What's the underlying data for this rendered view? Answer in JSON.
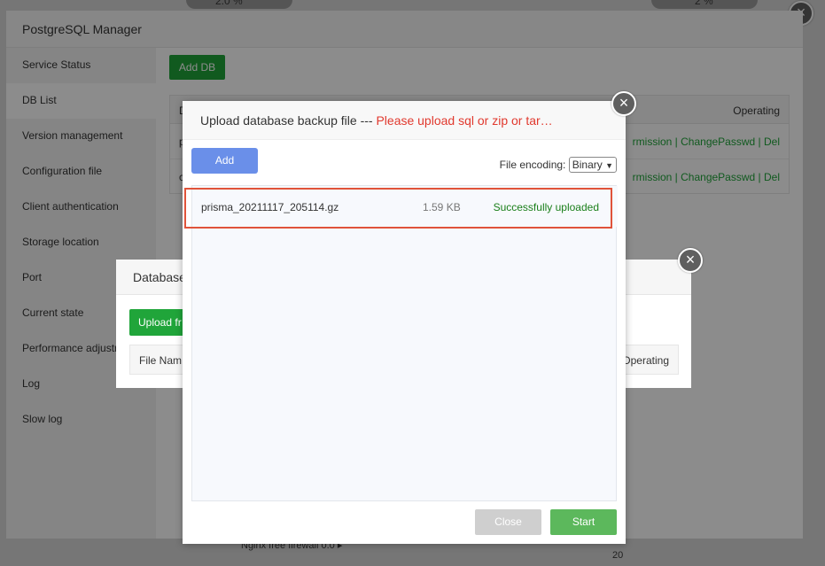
{
  "background": {
    "top_left_value": "2.0 %",
    "top_right_value": "2 %",
    "bottom_label": "Nginx free firewall 0.0 ▸",
    "bottom_value": "20"
  },
  "manager": {
    "title": "PostgreSQL Manager",
    "sidebar_items": [
      "Service Status",
      "DB List",
      "Version management",
      "Configuration file",
      "Client authentication",
      "Storage location",
      "Port",
      "Current state",
      "Performance adjustment",
      "Log",
      "Slow log"
    ],
    "add_db_label": "Add DB",
    "table_header_first": "D",
    "table_header_operating": "Operating",
    "rows": [
      {
        "first": "p",
        "permission": "rmission |",
        "change": "ChangePasswd |",
        "del": "Del"
      },
      {
        "first": "c",
        "permission": "rmission |",
        "change": "ChangePasswd |",
        "del": "Del"
      }
    ]
  },
  "backup_dialog": {
    "title": "Database",
    "upload_label": "Upload fr",
    "col_file_name": "File Nam",
    "col_operating": "Operating",
    "close_glyph": "×"
  },
  "upload_dialog": {
    "title": "Upload database backup file --- ",
    "warning": "Please upload sql or zip or tar…",
    "add_label": "Add",
    "encoding_label": "File encoding:",
    "encoding_value": "Binary",
    "close_glyph": "×",
    "files": [
      {
        "name": "prisma_20211117_205114.gz",
        "size": "1.59 KB",
        "status": "Successfully uploaded"
      }
    ],
    "close_button": "Close",
    "start_button": "Start"
  },
  "outer_close_glyph": "×",
  "colors": {
    "accent_green": "#20a53a",
    "add_button_blue": "#6a8fe9",
    "warning_red": "#e1392e",
    "highlight_border": "#e0533a",
    "status_green": "#1a7f1a"
  }
}
